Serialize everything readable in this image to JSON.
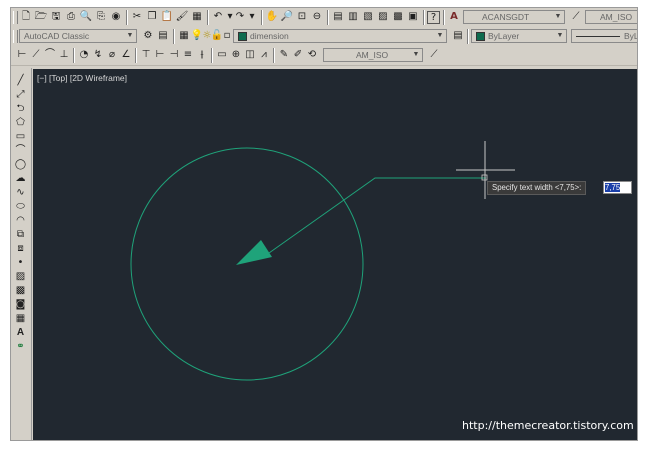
{
  "toolbar_standard": {
    "text_style_combo": "ACANSGDT",
    "dim_style_combo": "AM_ISO"
  },
  "toolbar_workspace": {
    "workspace_combo": "AutoCAD Classic",
    "layer_combo": "dimension",
    "color_combo": "ByLayer",
    "linetype_combo": "ByL"
  },
  "toolbar_dimension": {
    "dimstyle_combo": "AM_ISO"
  },
  "viewport": {
    "controls_label": "[−] [Top] [2D Wireframe]"
  },
  "dynamic_input": {
    "prompt": "Specify text width <7,75>:",
    "value": "7,75"
  },
  "watermark": "http://themecreator.tistory.com",
  "colors": {
    "canvas_bg": "#212830",
    "entity": "#1fa37a",
    "crosshair": "#c8c8c8",
    "ui_face": "#d4d0c8"
  }
}
